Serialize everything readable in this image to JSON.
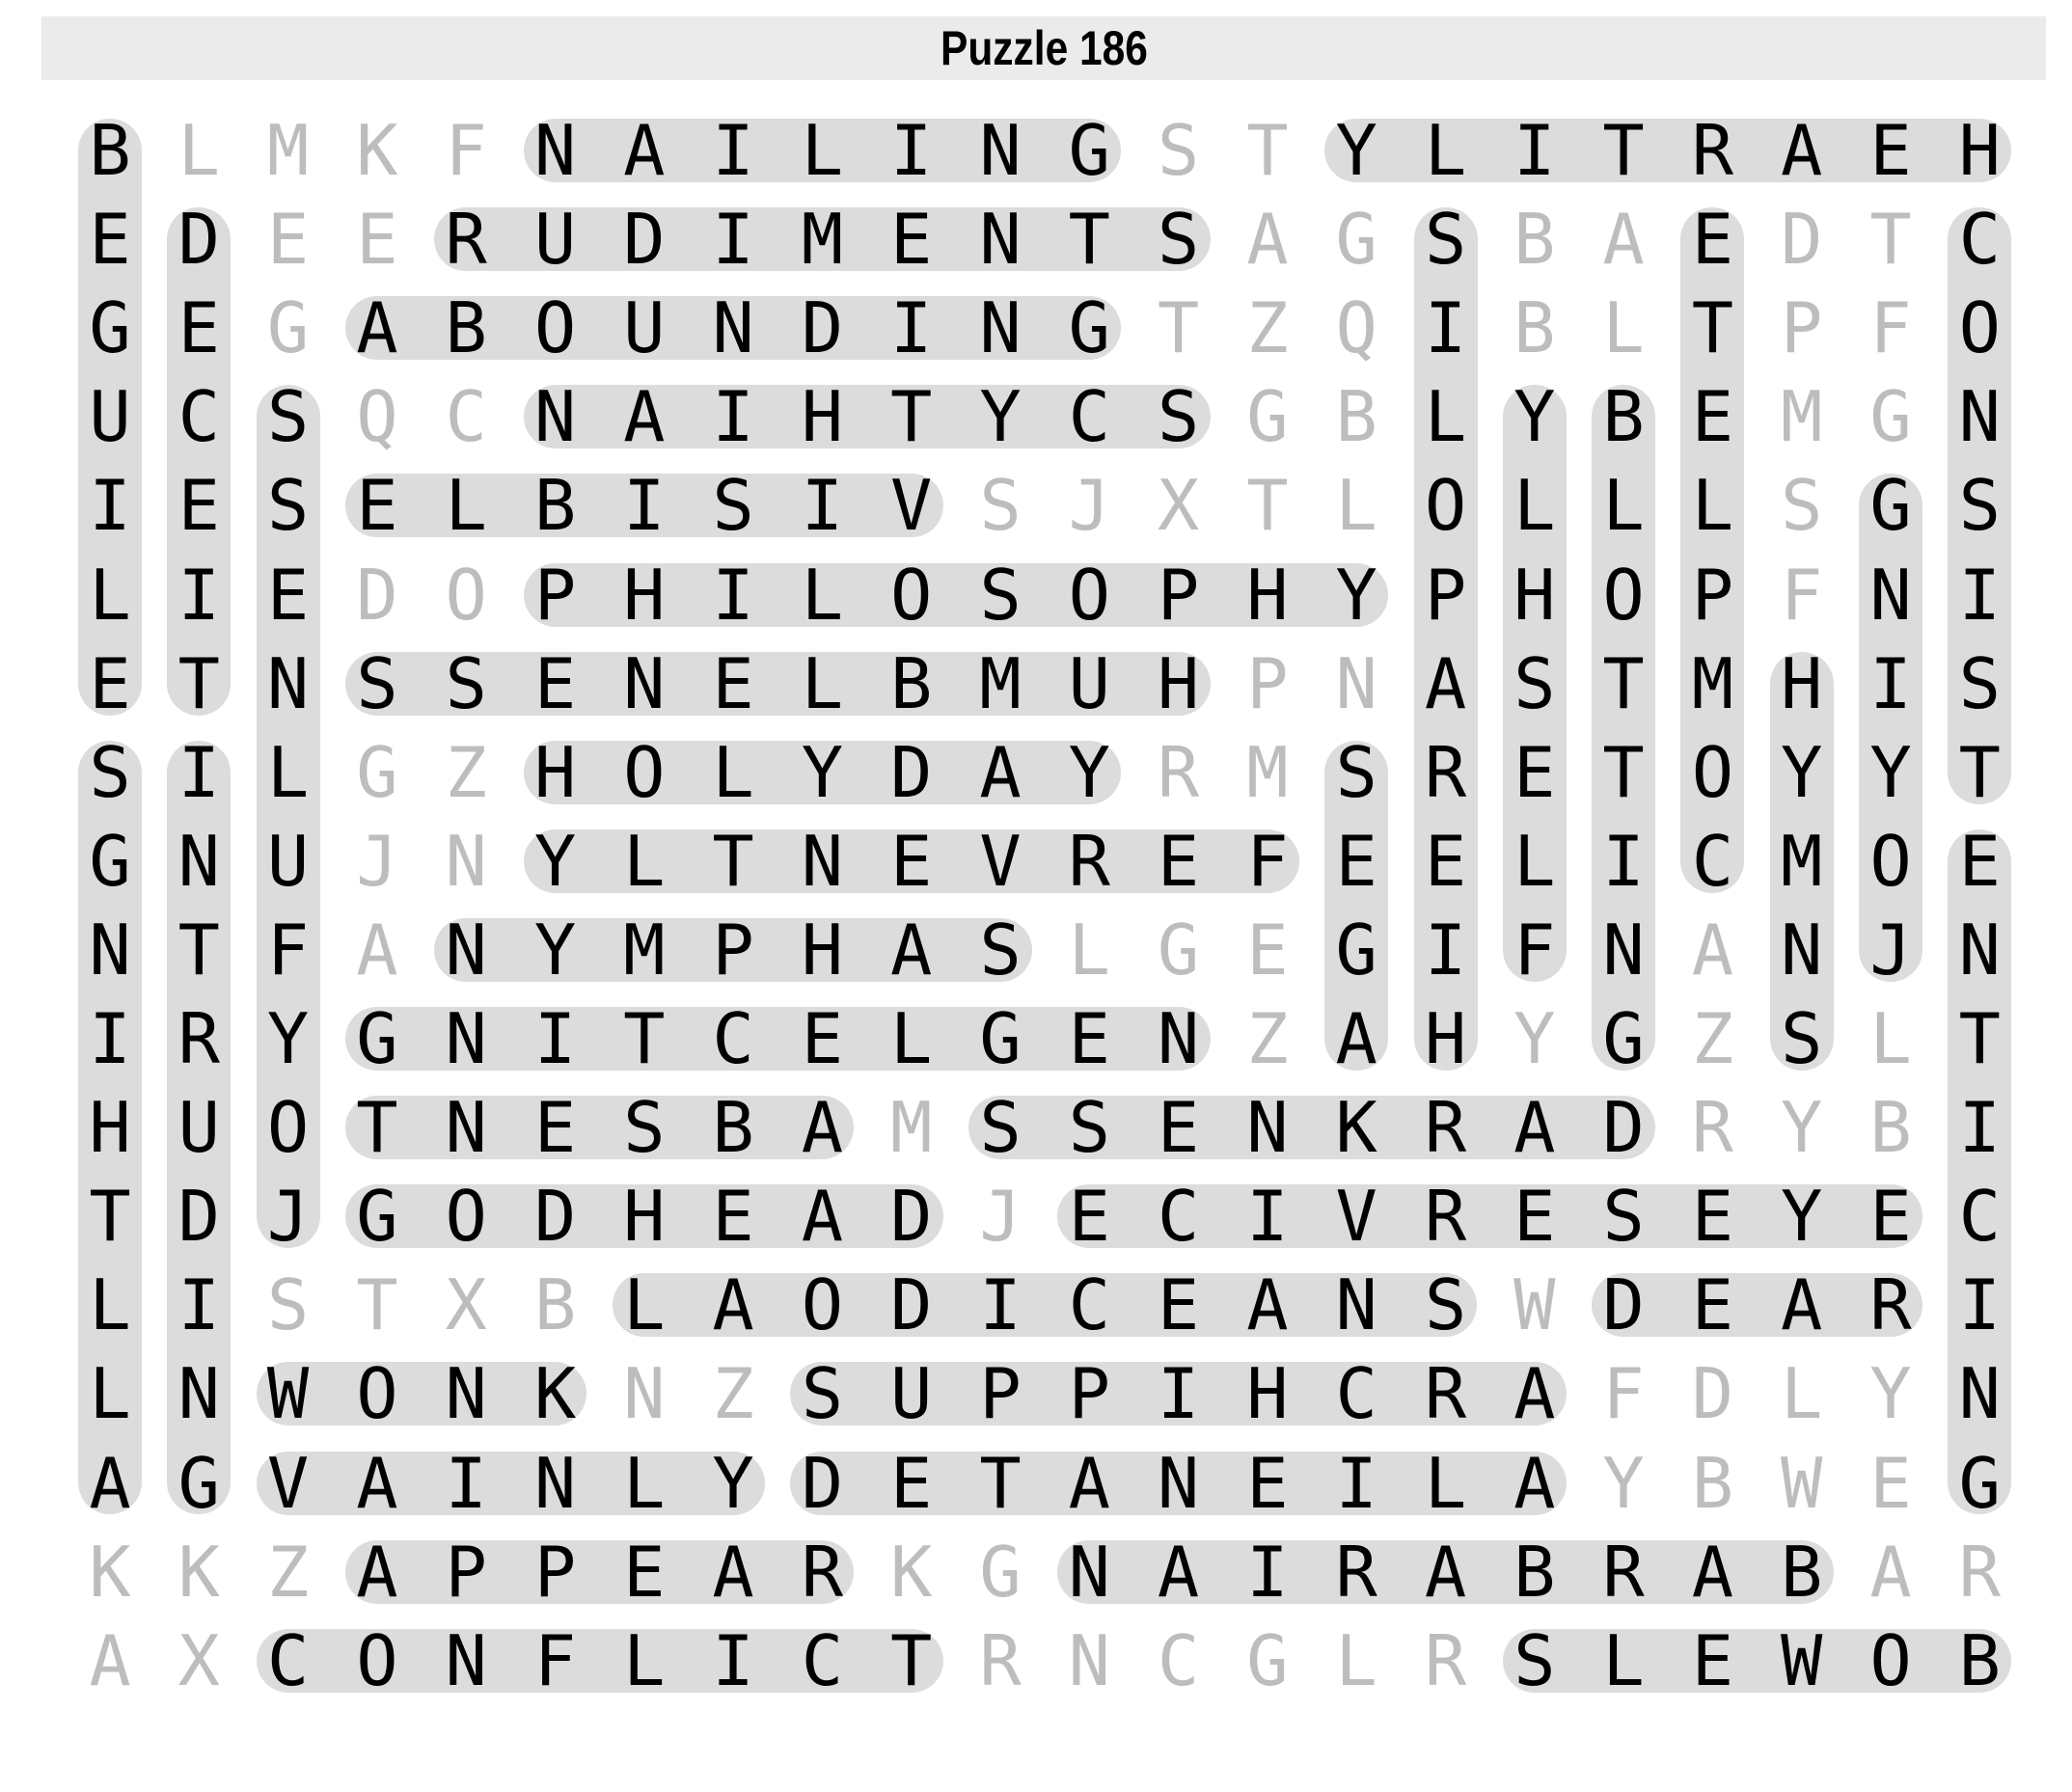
{
  "title": "Puzzle 186",
  "colors": {
    "found_letter": "#000000",
    "unfound_letter": "#bdbdbd",
    "highlight": "#dcdcdc",
    "title_bar": "#ebebeb"
  },
  "grid": [
    "BLMKFNAILINGSTYLITRAEH",
    "EDEERUDIMENTSAGSBAEDTC",
    "GEGABOUNDINGTZQIBLTPFO",
    "UCSQCNAIHTYCSGBLYBEMGN",
    "IESELBISIVSJXTLOLLLSGS",
    "LIEDOPHILOSOPHYPHOPFNI",
    "ETNSSENELBMUHPNASTMHIS",
    "SILGZHOLYDAYRMSRETOYYT",
    "GNUJNYLTNEVREFEELICMOE",
    "NTFANYMPHASLGEGIFNANJN",
    "IRYGNITCELGENZAHYGZSLT",
    "HUOTNESBAMSSENKRADRYBI",
    "TDJGODHEADJECIVRESEYEC",
    "LISTXBLAODICEANSWDEARI",
    "LNWONKNZSUPPIHCRAFDLYN",
    "AGVAINLYDETANEILAYBWEG",
    "KKZAPPEARKGNAIRABRABAR",
    "AXCONFLICTRNCGLRSLEWOB"
  ],
  "found_words": [
    {
      "word": "NAILING",
      "start": [
        0,
        5
      ],
      "end": [
        0,
        11
      ]
    },
    {
      "word": "HEARTILY",
      "start": [
        0,
        21
      ],
      "end": [
        0,
        14
      ]
    },
    {
      "word": "RUDIMENTS",
      "start": [
        1,
        4
      ],
      "end": [
        1,
        12
      ]
    },
    {
      "word": "ABOUNDING",
      "start": [
        2,
        3
      ],
      "end": [
        2,
        11
      ]
    },
    {
      "word": "SCYTHIAN",
      "start": [
        3,
        12
      ],
      "end": [
        3,
        5
      ]
    },
    {
      "word": "VISIBLE",
      "start": [
        4,
        9
      ],
      "end": [
        4,
        3
      ]
    },
    {
      "word": "PHILOSOPHY",
      "start": [
        5,
        5
      ],
      "end": [
        5,
        14
      ]
    },
    {
      "word": "HUMBLENESS",
      "start": [
        6,
        12
      ],
      "end": [
        6,
        3
      ]
    },
    {
      "word": "HOLYDAY",
      "start": [
        7,
        5
      ],
      "end": [
        7,
        11
      ]
    },
    {
      "word": "FERVENTLY",
      "start": [
        8,
        13
      ],
      "end": [
        8,
        5
      ]
    },
    {
      "word": "NYMPHAS",
      "start": [
        9,
        4
      ],
      "end": [
        9,
        10
      ]
    },
    {
      "word": "NEGLECTING",
      "start": [
        10,
        12
      ],
      "end": [
        10,
        3
      ]
    },
    {
      "word": "ABSENT",
      "start": [
        11,
        8
      ],
      "end": [
        11,
        3
      ]
    },
    {
      "word": "DARKNESS",
      "start": [
        11,
        17
      ],
      "end": [
        11,
        10
      ]
    },
    {
      "word": "GODHEAD",
      "start": [
        12,
        3
      ],
      "end": [
        12,
        9
      ]
    },
    {
      "word": "EYESERVICE",
      "start": [
        12,
        20
      ],
      "end": [
        12,
        11
      ]
    },
    {
      "word": "LAODICEANS",
      "start": [
        13,
        6
      ],
      "end": [
        13,
        15
      ]
    },
    {
      "word": "DEAR",
      "start": [
        13,
        17
      ],
      "end": [
        13,
        20
      ]
    },
    {
      "word": "KNOW",
      "start": [
        14,
        5
      ],
      "end": [
        14,
        2
      ]
    },
    {
      "word": "ARCHIPPUS",
      "start": [
        14,
        16
      ],
      "end": [
        14,
        8
      ]
    },
    {
      "word": "VAINLY",
      "start": [
        15,
        2
      ],
      "end": [
        15,
        7
      ]
    },
    {
      "word": "ALIENATED",
      "start": [
        15,
        16
      ],
      "end": [
        15,
        8
      ]
    },
    {
      "word": "APPEAR",
      "start": [
        16,
        3
      ],
      "end": [
        16,
        8
      ]
    },
    {
      "word": "BARBARIAN",
      "start": [
        16,
        19
      ],
      "end": [
        16,
        11
      ]
    },
    {
      "word": "CONFLICT",
      "start": [
        17,
        2
      ],
      "end": [
        17,
        9
      ]
    },
    {
      "word": "BOWELS",
      "start": [
        17,
        21
      ],
      "end": [
        17,
        16
      ]
    },
    {
      "word": "BEGUILE",
      "start": [
        0,
        0
      ],
      "end": [
        6,
        0
      ]
    },
    {
      "word": "ALLTHINGS",
      "start": [
        15,
        0
      ],
      "end": [
        7,
        0
      ]
    },
    {
      "word": "DECEIT",
      "start": [
        1,
        1
      ],
      "end": [
        6,
        1
      ]
    },
    {
      "word": "INTRUDING",
      "start": [
        7,
        1
      ],
      "end": [
        15,
        1
      ]
    },
    {
      "word": "JOYFULNESS",
      "start": [
        12,
        2
      ],
      "end": [
        3,
        2
      ]
    },
    {
      "word": "HIERAPOLIS",
      "start": [
        10,
        15
      ],
      "end": [
        1,
        15
      ]
    },
    {
      "word": "AGES",
      "start": [
        10,
        14
      ],
      "end": [
        7,
        14
      ]
    },
    {
      "word": "FLESHLY",
      "start": [
        9,
        16
      ],
      "end": [
        3,
        16
      ]
    },
    {
      "word": "BLOTTING",
      "start": [
        3,
        17
      ],
      "end": [
        10,
        17
      ]
    },
    {
      "word": "COMPLETE",
      "start": [
        8,
        18
      ],
      "end": [
        1,
        18
      ]
    },
    {
      "word": "HYMNS",
      "start": [
        6,
        19
      ],
      "end": [
        10,
        19
      ]
    },
    {
      "word": "JOYING",
      "start": [
        9,
        20
      ],
      "end": [
        4,
        20
      ]
    },
    {
      "word": "CONSIST",
      "start": [
        1,
        21
      ],
      "end": [
        7,
        21
      ]
    },
    {
      "word": "ENTICING",
      "start": [
        8,
        21
      ],
      "end": [
        15,
        21
      ]
    }
  ]
}
